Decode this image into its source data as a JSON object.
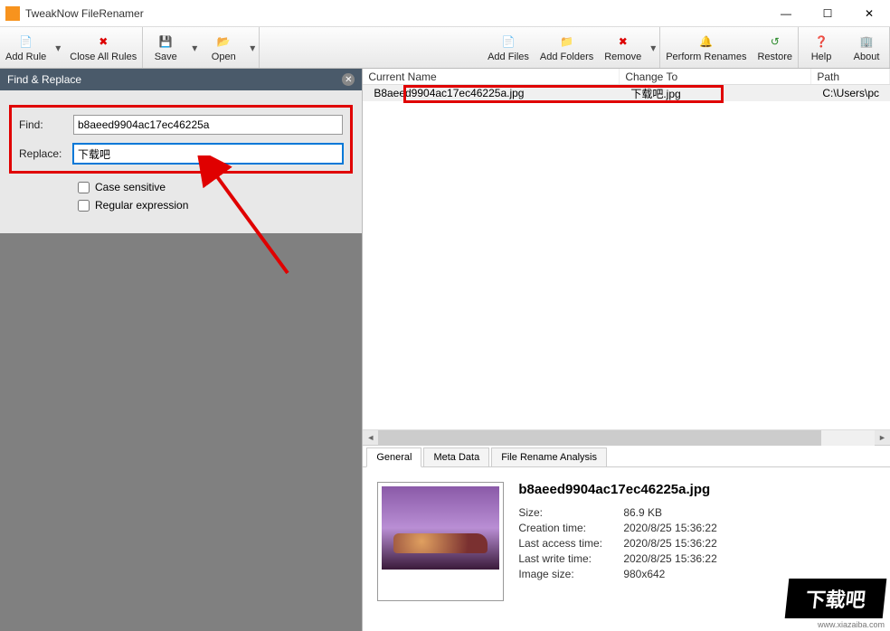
{
  "title": "TweakNow FileRenamer",
  "toolbar": {
    "add_rule": "Add Rule",
    "close_all_rules": "Close All Rules",
    "save": "Save",
    "open": "Open",
    "add_files": "Add Files",
    "add_folders": "Add Folders",
    "remove": "Remove",
    "perform_renames": "Perform Renames",
    "restore": "Restore",
    "help": "Help",
    "about": "About"
  },
  "panel": {
    "title": "Find & Replace",
    "find_label": "Find:",
    "find_value": "b8aeed9904ac17ec46225a",
    "replace_label": "Replace:",
    "replace_value": "下载吧",
    "case_sensitive": "Case sensitive",
    "regular_expression": "Regular expression"
  },
  "list": {
    "columns": {
      "current": "Current Name",
      "change": "Change To",
      "path": "Path"
    },
    "rows": [
      {
        "current": "B8aeed9904ac17ec46225a.jpg",
        "change": "下载吧.jpg",
        "path": "C:\\Users\\pc"
      }
    ]
  },
  "tabs": {
    "general": "General",
    "meta": "Meta Data",
    "analysis": "File Rename Analysis"
  },
  "detail": {
    "filename": "b8aeed9904ac17ec46225a.jpg",
    "size_k": "Size:",
    "size_v": "86.9 KB",
    "ctime_k": "Creation time:",
    "ctime_v": "2020/8/25 15:36:22",
    "atime_k": "Last access time:",
    "atime_v": "2020/8/25 15:36:22",
    "wtime_k": "Last write time:",
    "wtime_v": "2020/8/25 15:36:22",
    "isize_k": "Image size:",
    "isize_v": "980x642"
  },
  "watermark_url": "www.xiazaiba.com",
  "watermark_logo": "下载吧"
}
